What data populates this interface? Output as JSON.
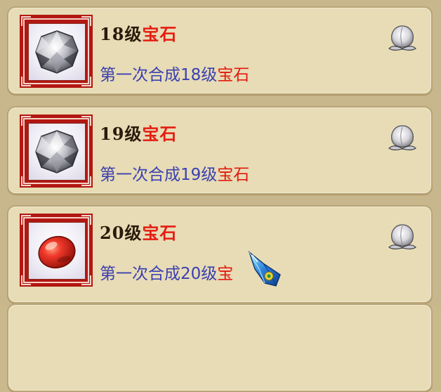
{
  "achievements": [
    {
      "level_label": "18级",
      "name_label": "宝石",
      "desc_prefix": "第一次合成18级",
      "desc_highlight": "宝石",
      "gem_color": "white",
      "icon": "white-gem-icon",
      "reward_icon": "peach-icon"
    },
    {
      "level_label": "19级",
      "name_label": "宝石",
      "desc_prefix": "第一次合成19级",
      "desc_highlight": "宝石",
      "gem_color": "white",
      "icon": "white-gem-icon",
      "reward_icon": "peach-icon"
    },
    {
      "level_label": "20级",
      "name_label": "宝石",
      "desc_prefix": "第一次合成20级",
      "desc_highlight": "宝",
      "gem_color": "red",
      "icon": "red-gem-icon",
      "reward_icon": "peach-icon",
      "overlay_icon": "blue-crystal-icon"
    }
  ],
  "colors": {
    "level_text": "#2a1a0a",
    "name_text": "#e61c12",
    "desc_text": "#3b3fb0",
    "highlight_text": "#e21a10",
    "frame": "#b31712",
    "card_bg": "#e7dcb6",
    "panel_bg": "#c8b78c"
  }
}
